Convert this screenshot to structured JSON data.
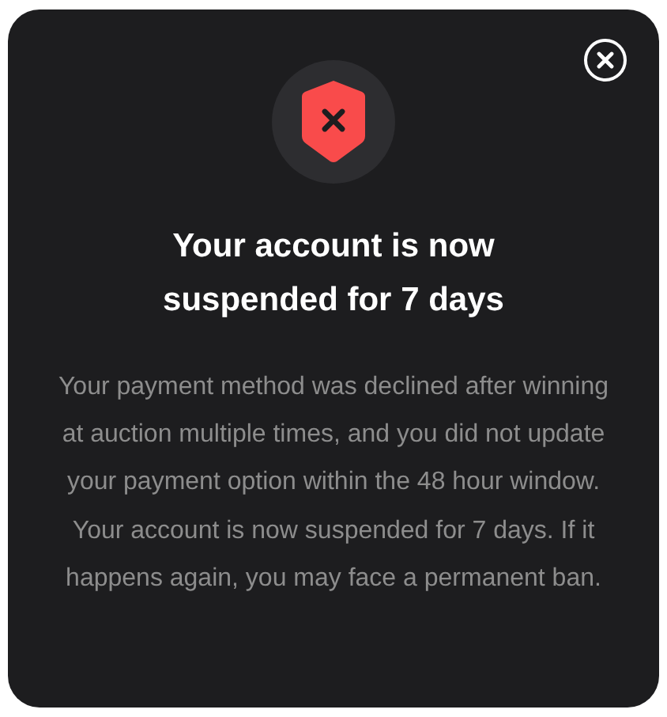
{
  "dialog": {
    "title": "Your account is now suspended for 7 days",
    "message": "Your payment method was declined after winning at auction multiple times, and you did not update your payment option within the 48 hour window. Your account is now suspended for 7 days. If it happens again, you may face a permanent ban."
  }
}
